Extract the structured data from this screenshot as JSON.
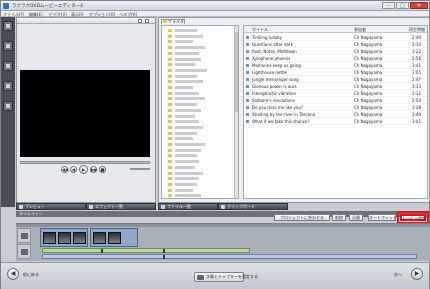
{
  "window": {
    "title": "ラクラクDVDムービーエディター4",
    "minimize": "–",
    "maximize": "□",
    "close": "✕"
  },
  "menu": [
    "ファイル(F)",
    "編集(E)",
    "ビデオ(V)",
    "表示(I)",
    "オプション(O)",
    "ヘルプ(H)"
  ],
  "preview": {
    "tabs": [
      "プレビュー",
      "エフェクト一覧"
    ],
    "controls": [
      "◀◀",
      "◀",
      "▶",
      "▶▶",
      "■"
    ]
  },
  "browser": {
    "folder_tab": "フォルダ",
    "tree_items": [
      {
        "w": 22
      },
      {
        "w": 28
      },
      {
        "w": 18
      },
      {
        "w": 30
      },
      {
        "w": 24
      },
      {
        "w": 26
      },
      {
        "w": 20
      },
      {
        "w": 32
      },
      {
        "w": 22
      },
      {
        "w": 28
      },
      {
        "w": 18
      },
      {
        "w": 24
      },
      {
        "w": 30
      },
      {
        "w": 22
      },
      {
        "w": 26
      },
      {
        "w": 20
      },
      {
        "w": 24
      },
      {
        "w": 28
      },
      {
        "w": 22
      },
      {
        "w": 18
      },
      {
        "w": 30
      },
      {
        "w": 26
      },
      {
        "w": 22
      },
      {
        "w": 24
      },
      {
        "w": 20
      },
      {
        "w": 28
      },
      {
        "w": 24
      },
      {
        "w": 22
      },
      {
        "w": 18
      },
      {
        "w": 26
      }
    ],
    "columns": {
      "title": "タイトル",
      "artist": "参加者",
      "year": "再生時間"
    },
    "files": [
      {
        "title": "Tinkling lullaby",
        "artist": "Ch Nagayama",
        "time": "2:49"
      },
      {
        "title": "Questions after dark",
        "artist": "Ch Nagayama",
        "time": "3:10"
      },
      {
        "title": "Rust, Notes, Meltdown",
        "artist": "Ch Nagayama",
        "time": "3:22"
      },
      {
        "title": "Xylophone phoenix",
        "artist": "Ch Nagayama",
        "time": "2:58"
      },
      {
        "title": "Memories keep us going",
        "artist": "Ch Nagayama",
        "time": "3:41"
      },
      {
        "title": "Lighthouse nettle",
        "artist": "Ch Nagayama",
        "time": "3:05"
      },
      {
        "title": "Jungle messenger song",
        "artist": "Ch Nagayama",
        "time": "2:47"
      },
      {
        "title": "Glorious power is ours",
        "artist": "Ch Nagayama",
        "time": "3:33"
      },
      {
        "title": "Intergalactic vibration",
        "artist": "Ch Nagayama",
        "time": "3:12"
      },
      {
        "title": "Solitaire's revolutions",
        "artist": "Ch Nagayama",
        "time": "2:54"
      },
      {
        "title": "Do you miss me like you?",
        "artist": "Ch Nagayama",
        "time": "3:28"
      },
      {
        "title": "Strolling by the river in Toscana",
        "artist": "Ch Nagayama",
        "time": "3:49"
      },
      {
        "title": "What if we take this chance?",
        "artist": "Ch Nagayama",
        "time": "3:01"
      }
    ],
    "bottom_tabs": [
      "ファイル一覧",
      "クリップボード"
    ]
  },
  "timeline": {
    "label": "タイムライン",
    "buttons": {
      "fit": "プロジェクトに合わせる",
      "delete": "削除",
      "split": "分割",
      "auto": "オートフィット",
      "movie_settings": "ムービー設定"
    }
  },
  "bottombar": {
    "back_label": "前に戻る",
    "center_button": "字幕とチャプターを設定する",
    "next_label": "次へ",
    "back_icon": "◀",
    "next_icon": "▶"
  },
  "colors": {
    "highlight": "#e8121a"
  }
}
